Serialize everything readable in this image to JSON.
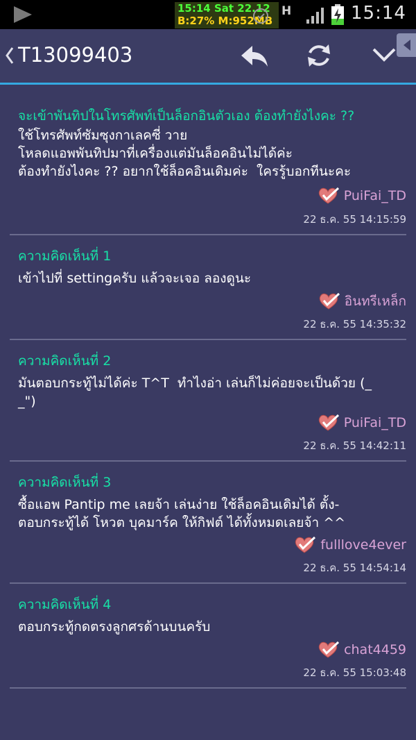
{
  "status_bar": {
    "sysinfo_line1": "15:14 Sat 22.12",
    "sysinfo_line2": "B:27% M:952MB",
    "network": "H",
    "clock": "15:14"
  },
  "header": {
    "thread_id": "T13099403"
  },
  "topic": {
    "title": "จะเข้าพันทิปในโทรศัพท์เป็นล็อกอินตัวเอง ต้องทำยังไงคะ ??",
    "body": "ใช้โทรศัพท์ซัมซุงกาเลคซี่ วาย\nโหลดแอพพันทิปมาที่เครื่องแต่มันล็อคอินไม่ได้ค่ะ\nต้องทำยังไงคะ ?? อยากใช้ล็อคอินเดิมค่ะ  ใครรู้บอกทีนะคะ",
    "author": "PuiFai_TD",
    "time": "22 ธ.ค. 55 14:15:59"
  },
  "comments": [
    {
      "label": "ความคิดเห็นที่ 1",
      "body": "เข้าไปที่ settingครับ แล้วจะเจอ ลองดูนะ",
      "author": "อินทรีเหล็ก",
      "time": "22 ธ.ค. 55 14:35:32"
    },
    {
      "label": "ความคิดเห็นที่ 2",
      "body": "มันตอบกระทู้ไม่ได้ค่ะ T^T  ทำไงอ่า เล่นก็ไม่ค่อยจะเป็นด้วย (_\n_\")",
      "author": "PuiFai_TD",
      "time": "22 ธ.ค. 55 14:42:11"
    },
    {
      "label": "ความคิดเห็นที่ 3",
      "body": "ซื้อแอพ Pantip me เลยจ้า เล่นง่าย ใช้ล็อคอินเดิมได้ ตั้ง-\nตอบกระทู้ได้ โหวต บุคมาร์ค ให้กิฟต์ ได้ทั้งหมดเลยจ้า ^^",
      "author": "fulllove4ever",
      "time": "22 ธ.ค. 55 14:54:14"
    },
    {
      "label": "ความคิดเห็นที่ 4",
      "body": "ตอบกระทู้กดตรงลูกศรด้านบนครับ",
      "author": "chat4459",
      "time": "22 ธ.ค. 55 15:03:48"
    }
  ],
  "colors": {
    "background": "#3a3a62",
    "accent_title": "#18e0a6",
    "author": "#d9a3d6",
    "header_line": "#35a9e1"
  },
  "icons": [
    "play-icon",
    "alarm-icon",
    "signal-icon",
    "battery-icon",
    "back-icon",
    "reply-icon",
    "refresh-icon",
    "menu-chevron-icon",
    "heart-check-icon"
  ]
}
